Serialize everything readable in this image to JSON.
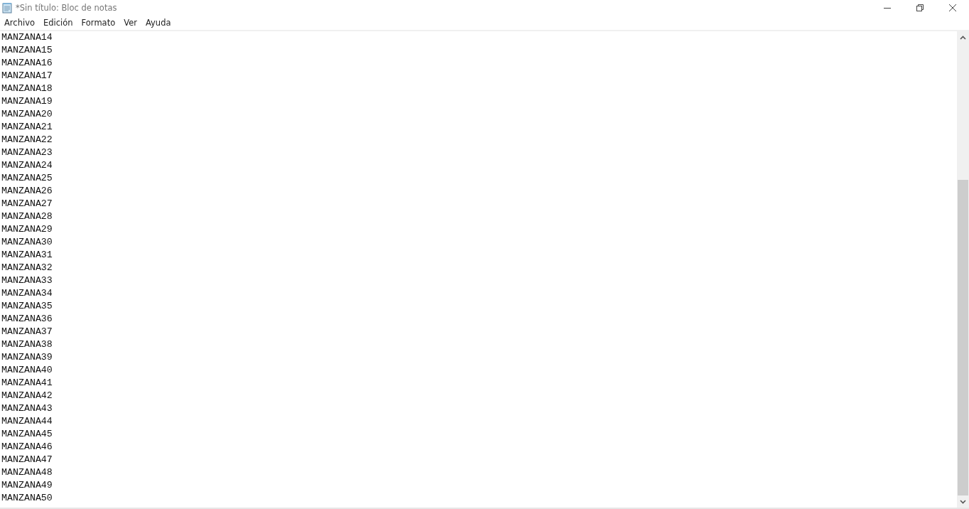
{
  "window": {
    "title": "*Sin título: Bloc de notas"
  },
  "menu": [
    "Archivo",
    "Edición",
    "Formato",
    "Ver",
    "Ayuda"
  ],
  "editor": {
    "lines": [
      "MANZANA14",
      "MANZANA15",
      "MANZANA16",
      "MANZANA17",
      "MANZANA18",
      "MANZANA19",
      "MANZANA20",
      "MANZANA21",
      "MANZANA22",
      "MANZANA23",
      "MANZANA24",
      "MANZANA25",
      "MANZANA26",
      "MANZANA27",
      "MANZANA28",
      "MANZANA29",
      "MANZANA30",
      "MANZANA31",
      "MANZANA32",
      "MANZANA33",
      "MANZANA34",
      "MANZANA35",
      "MANZANA36",
      "MANZANA37",
      "MANZANA38",
      "MANZANA39",
      "MANZANA40",
      "MANZANA41",
      "MANZANA42",
      "MANZANA43",
      "MANZANA44",
      "MANZANA45",
      "MANZANA46",
      "MANZANA47",
      "MANZANA48",
      "MANZANA49",
      "MANZANA50"
    ]
  }
}
